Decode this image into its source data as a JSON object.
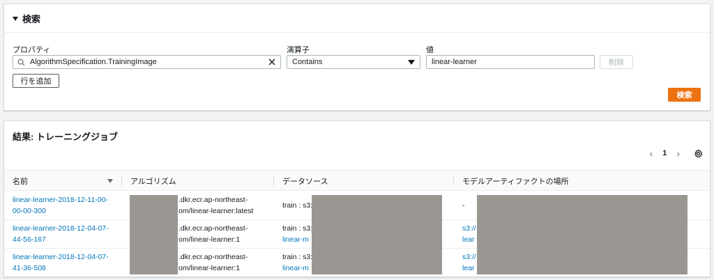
{
  "search": {
    "title": "検索",
    "property_label": "プロパティ",
    "operator_label": "演算子",
    "value_label": "値",
    "property_value": "AlgorithmSpecification.TrainingImage",
    "operator_value": "Contains",
    "value_value": "linear-learner",
    "delete_label": "削除",
    "add_row_label": "行を追加",
    "search_button_label": "検索"
  },
  "results": {
    "title": "結果: トレーニングジョブ",
    "page": "1",
    "columns": [
      "名前",
      "アルゴリズム",
      "データソース",
      "モデルアーティファクトの場所"
    ],
    "rows": [
      {
        "name_line1": "linear-learner-2018-12-11-00-",
        "name_line2": "00-00-300",
        "algo_line1": ".dkr.ecr.ap-northeast-",
        "algo_line2": "om/linear-learner:latest",
        "data_line1": "train : s3:",
        "data_line2": "",
        "artifact_line1": "-",
        "artifact_line2": ""
      },
      {
        "name_line1": "linear-learner-2018-12-04-07-",
        "name_line2": "44-56-167",
        "algo_line1": ".dkr.ecr.ap-northeast-",
        "algo_line2": "om/linear-learner:1",
        "data_line1": "train : s3:",
        "data_line2": "linear-m",
        "artifact_line1": "s3://",
        "artifact_line2": "lear"
      },
      {
        "name_line1": "linear-learner-2018-12-04-07-",
        "name_line2": "41-36-508",
        "algo_line1": ".dkr.ecr.ap-northeast-",
        "algo_line2": "om/linear-learner:1",
        "data_line1": "train : s3:",
        "data_line2": "linear-m",
        "artifact_line1": "s3://",
        "artifact_line2": "lear"
      }
    ]
  }
}
